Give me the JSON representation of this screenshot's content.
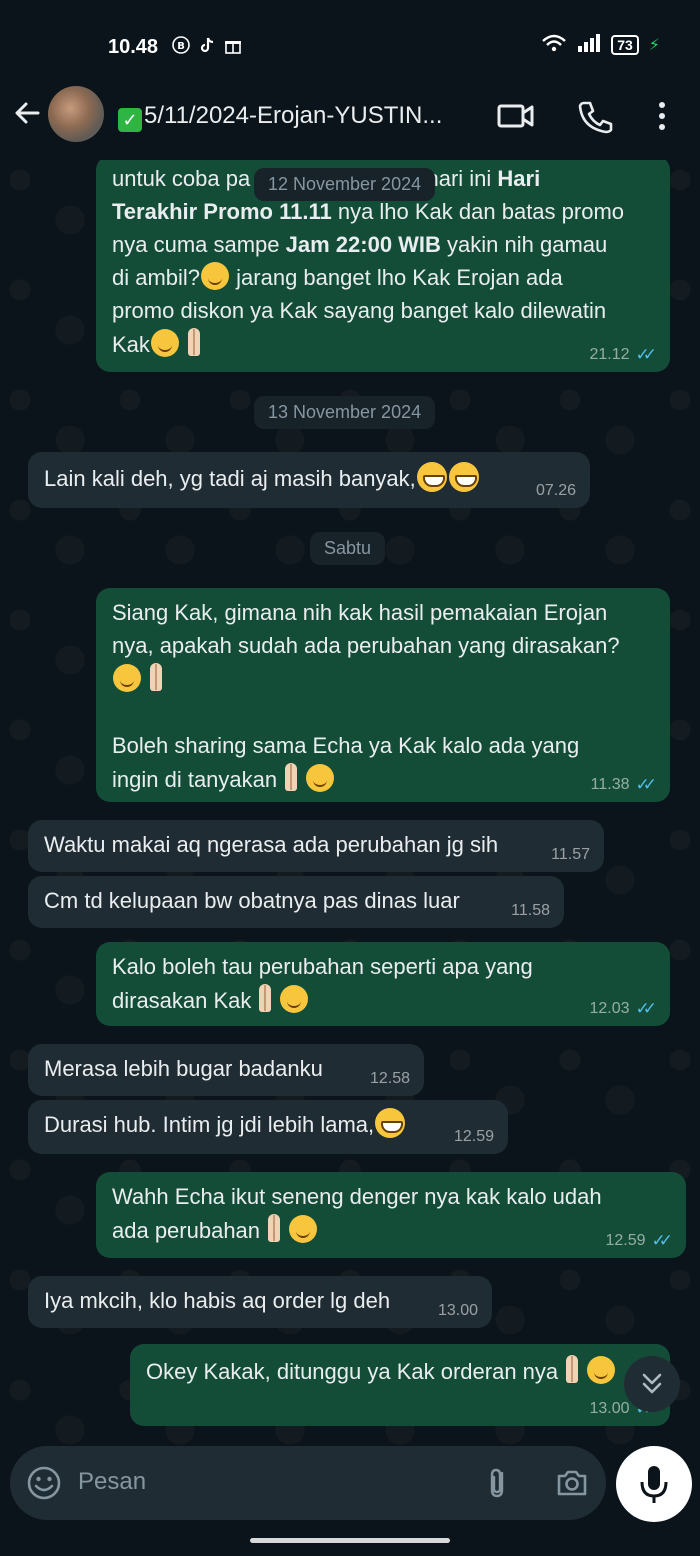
{
  "status_bar": {
    "time": "10.48",
    "battery": "73",
    "icons": [
      "bbm-icon",
      "tiktok-icon",
      "gift-icon",
      "wifi-icon",
      "signal-icon",
      "battery-icon",
      "charging-icon"
    ]
  },
  "header": {
    "title": "5/11/2024-Erojan-YUSTIN...",
    "icons": [
      "back-arrow-icon",
      "avatar",
      "verified-check-icon",
      "video-call-icon",
      "voice-call-icon",
      "more-options-icon"
    ]
  },
  "messages": [
    {
      "dir": "out",
      "lines": [
        [
          "untuk coba pa",
          ""
        ],
        [
          "",
          ""
        ]
      ],
      "text_1": "untuk coba pa",
      "text_1b": "Kak? hari ini ",
      "bold_1": "Hari",
      "text_2_bold": "Terakhir Promo 11.11",
      "text_2": " nya lho Kak dan batas promo",
      "text_3": "nya cuma sampe ",
      "bold_3": "Jam 22:00 WIB",
      "text_3b": "  yakin nih gamau",
      "text_4": "di ambil?",
      "text_4b": " jarang banget lho Kak Erojan ada",
      "text_5": "promo diskon ya Kak sayang banget kalo dilewatin",
      "text_6": "Kak",
      "time": "21.12"
    },
    {
      "dir": "in",
      "text": "Lain kali deh, yg tadi aj masih banyak,",
      "time": "07.26"
    },
    {
      "dir": "out",
      "text_1": "Siang Kak, gimana nih kak hasil pemakaian Erojan",
      "text_2": "nya, apakah sudah ada perubahan yang dirasakan?",
      "text_3": "Boleh sharing sama Echa ya Kak kalo ada yang",
      "text_4": "ingin di tanyakan",
      "time": "11.38"
    },
    {
      "dir": "in",
      "text": "Waktu makai aq ngerasa ada perubahan jg sih",
      "time": "11.57"
    },
    {
      "dir": "in",
      "text": "Cm td kelupaan bw obatnya pas dinas luar",
      "time": "11.58"
    },
    {
      "dir": "out",
      "text_1": "Kalo boleh tau perubahan seperti apa yang",
      "text_2": "dirasakan Kak",
      "time": "12.03"
    },
    {
      "dir": "in",
      "text": "Merasa lebih bugar badanku",
      "time": "12.58"
    },
    {
      "dir": "in",
      "text": "Durasi hub. Intim jg jdi lebih lama,",
      "time": "12.59"
    },
    {
      "dir": "out",
      "text_1": "Wahh Echa ikut seneng denger nya kak kalo udah",
      "text_2": "ada perubahan",
      "time": "12.59"
    },
    {
      "dir": "in",
      "text": "Iya mkcih, klo habis aq order lg deh",
      "time": "13.00"
    },
    {
      "dir": "out",
      "text_1": "Okey Kakak, ditunggu ya Kak orderan nya",
      "time": "13.00"
    }
  ],
  "dates": {
    "d1": "12 November 2024",
    "d2": "13 November 2024",
    "d3": "Sabtu"
  },
  "composer": {
    "placeholder": "Pesan",
    "icons": [
      "emoji-icon",
      "attach-icon",
      "camera-icon",
      "mic-icon"
    ]
  },
  "colors": {
    "background": "#0b141a",
    "outgoing_bubble": "#144d37",
    "incoming_bubble": "#202c33",
    "read_ticks": "#53bdeb"
  }
}
